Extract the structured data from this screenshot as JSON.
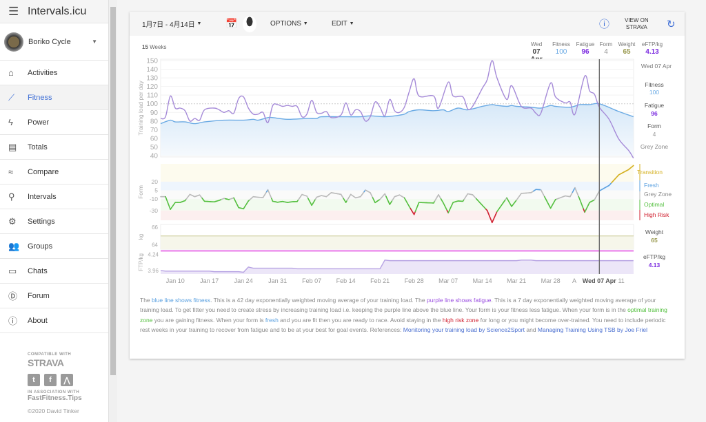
{
  "app": {
    "title": "Intervals.icu",
    "menu_icon": "hamburger-icon"
  },
  "profile": {
    "name": "Boriko Cycle"
  },
  "sidebar": {
    "items": [
      {
        "label": "Activities",
        "icon": "⌂",
        "name": "home-icon"
      },
      {
        "label": "Fitness",
        "icon": "⟋",
        "name": "trending-up-icon",
        "active": true
      },
      {
        "label": "Power",
        "icon": "ϟ",
        "name": "bolt-icon"
      },
      {
        "label": "Totals",
        "icon": "▤",
        "name": "totals-icon"
      },
      {
        "label": "Compare",
        "icon": "≈",
        "name": "compare-icon"
      },
      {
        "label": "Intervals",
        "icon": "⚲",
        "name": "search-icon"
      },
      {
        "label": "Settings",
        "icon": "⚙",
        "name": "gear-icon"
      },
      {
        "label": "Groups",
        "icon": "👥",
        "name": "groups-icon"
      },
      {
        "label": "Chats",
        "icon": "▭",
        "name": "chat-icon"
      },
      {
        "label": "Forum",
        "icon": "Ⓓ",
        "name": "forum-icon"
      },
      {
        "label": "About",
        "icon": "ⓘ",
        "name": "info-icon"
      }
    ]
  },
  "footer": {
    "compatible": "COMPATIBLE WITH",
    "strava": "STRAVA",
    "association": "IN ASSOCIATION WITH",
    "fastfitness": "FastFitness.Tips",
    "copyright": "©2020 David Tinker"
  },
  "toolbar": {
    "date_range": "1月7日 - 4月14日",
    "options": "OPTIONS",
    "edit": "EDIT",
    "view_on": "VIEW ON",
    "strava": "STRAVA"
  },
  "summary": {
    "weeks_num": "15",
    "weeks_label": "Weeks",
    "day": "Wed",
    "date": "07 Apr",
    "fitness_label": "Fitness",
    "fitness": "100",
    "fatigue_label": "Fatigue",
    "fatigue": "96",
    "form_label": "Form",
    "form": "4",
    "weight_label": "Weight",
    "weight": "65",
    "eftp_label": "eFTP/kg",
    "eftp": "4.13"
  },
  "right_panel": {
    "date": "Wed 07 Apr",
    "fitness_label": "Fitness",
    "fitness": "100",
    "fatigue_label": "Fatigue",
    "fatigue": "96",
    "form_label": "Form",
    "form": "4",
    "zone": "Grey Zone",
    "zones": [
      "Transition",
      "Fresh",
      "Grey Zone",
      "Optimal",
      "High Risk"
    ],
    "weight_label": "Weight",
    "weight": "65",
    "eftp_label": "eFTP/kg",
    "eftp": "4.13"
  },
  "colors": {
    "fitness": "#6aaae4",
    "fatigue": "#a58ad8",
    "fatigue_text": "#7b2be0",
    "weight": "#9a9a50",
    "transition": "#d4b020",
    "fresh": "#5aa0e0",
    "grey": "#bbbbbb",
    "optimal": "#55c040",
    "high_risk": "#d02030",
    "accent": "#3f6fd6"
  },
  "description": {
    "p1": "The ",
    "l1": "blue line shows fitness",
    "p2": ". This is a 42 day exponentially weighted moving average of your training load. The ",
    "l2": "purple line shows fatigue",
    "p3": ". This is a 7 day exponentially weighted moving average of your training load. To get fitter you need to create stress by increasing training load i.e. keeping the purple line above the blue line. Your form is your fitness less fatigue. When your form is in the ",
    "l3": "optimal training zone",
    "p4": " you are gaining fitness. When your form is ",
    "l4": "fresh",
    "p5": " and you are fit then you are ready to race. Avoid staying in the ",
    "l5": "high risk zone",
    "p6": " for long or you might become over-trained. You need to include periodic rest weeks in your training to recover from fatigue and to be at your best for goal events. References: ",
    "l6": "Monitoring your training load by Science2Sport",
    "p7": " and ",
    "l7": "Managing Training Using TSB by Joe Friel"
  },
  "chart_data": {
    "type": "line",
    "x_range": [
      "Jan 07",
      "Apr 14"
    ],
    "x_ticks": [
      "Jan 10",
      "Jan 17",
      "Jan 24",
      "Jan 31",
      "Feb 07",
      "Feb 14",
      "Feb 21",
      "Feb 28",
      "Mar 07",
      "Mar 14",
      "Mar 21",
      "Mar 28",
      "A",
      "Wed 07 Apr",
      "11"
    ],
    "selected_date": "Apr 07",
    "panels": [
      {
        "ylabel": "Training load per day",
        "ylim": [
          40,
          150
        ],
        "yticks": [
          150,
          140,
          130,
          120,
          110,
          100,
          90,
          80,
          70,
          60,
          50,
          40
        ],
        "series": [
          {
            "name": "Fitness",
            "color": "#6aaae4",
            "points": [
              [
                "Jan 07",
                77
              ],
              [
                "Jan 09",
                81
              ],
              [
                "Jan 10",
                79
              ],
              [
                "Jan 12",
                79
              ],
              [
                "Jan 14",
                77
              ],
              [
                "Jan 16",
                79
              ],
              [
                "Jan 20",
                81
              ],
              [
                "Jan 24",
                81
              ],
              [
                "Jan 26",
                82
              ],
              [
                "Jan 27",
                81
              ],
              [
                "Jan 29",
                84
              ],
              [
                "Jan 30",
                84
              ],
              [
                "Feb 02",
                82
              ],
              [
                "Feb 06",
                83
              ],
              [
                "Feb 08",
                83
              ],
              [
                "Feb 09",
                85
              ],
              [
                "Feb 13",
                85
              ],
              [
                "Feb 17",
                85
              ],
              [
                "Feb 19",
                86
              ],
              [
                "Feb 22",
                85
              ],
              [
                "Feb 24",
                86
              ],
              [
                "Feb 26",
                88
              ],
              [
                "Feb 27",
                91
              ],
              [
                "Mar 01",
                93
              ],
              [
                "Mar 04",
                92
              ],
              [
                "Mar 06",
                93
              ],
              [
                "Mar 07",
                91
              ],
              [
                "Mar 09",
                95
              ],
              [
                "Mar 11",
                93
              ],
              [
                "Mar 14",
                97
              ],
              [
                "Mar 16",
                99
              ],
              [
                "Mar 17",
                98
              ],
              [
                "Mar 19",
                97
              ],
              [
                "Mar 20",
                98
              ],
              [
                "Mar 21",
                97
              ],
              [
                "Mar 24",
                96
              ],
              [
                "Mar 26",
                95
              ],
              [
                "Mar 28",
                98
              ],
              [
                "Mar 29",
                97
              ],
              [
                "Apr 01",
                96
              ],
              [
                "Apr 03",
                99
              ],
              [
                "Apr 05",
                99
              ],
              [
                "Apr 07",
                100
              ],
              [
                "Apr 11",
                91
              ],
              [
                "Apr 14",
                85
              ]
            ]
          },
          {
            "name": "Fatigue",
            "color": "#a58ad8",
            "points": [
              [
                "Jan 07",
                83
              ],
              [
                "Jan 08",
                85
              ],
              [
                "Jan 09",
                109
              ],
              [
                "Jan 10",
                95
              ],
              [
                "Jan 11",
                95
              ],
              [
                "Jan 12",
                92
              ],
              [
                "Jan 13",
                80
              ],
              [
                "Jan 14",
                83
              ],
              [
                "Jan 15",
                81
              ],
              [
                "Jan 16",
                93
              ],
              [
                "Jan 18",
                95
              ],
              [
                "Jan 19",
                93
              ],
              [
                "Jan 20",
                90
              ],
              [
                "Jan 21",
                92
              ],
              [
                "Jan 22",
                89
              ],
              [
                "Jan 23",
                106
              ],
              [
                "Jan 24",
                108
              ],
              [
                "Jan 25",
                95
              ],
              [
                "Jan 26",
                88
              ],
              [
                "Jan 27",
                88
              ],
              [
                "Jan 28",
                90
              ],
              [
                "Jan 29",
                78
              ],
              [
                "Jan 30",
                98
              ],
              [
                "Jan 31",
                99
              ],
              [
                "Feb 01",
                97
              ],
              [
                "Feb 02",
                98
              ],
              [
                "Feb 03",
                97
              ],
              [
                "Feb 04",
                97
              ],
              [
                "Feb 05",
                85
              ],
              [
                "Feb 06",
                88
              ],
              [
                "Feb 07",
                104
              ],
              [
                "Feb 08",
                90
              ],
              [
                "Feb 09",
                89
              ],
              [
                "Feb 10",
                91
              ],
              [
                "Feb 11",
                84
              ],
              [
                "Feb 13",
                87
              ],
              [
                "Feb 14",
                101
              ],
              [
                "Feb 15",
                87
              ],
              [
                "Feb 16",
                93
              ],
              [
                "Feb 17",
                91
              ],
              [
                "Feb 18",
                80
              ],
              [
                "Feb 19",
                85
              ],
              [
                "Feb 20",
                102
              ],
              [
                "Feb 21",
                96
              ],
              [
                "Feb 22",
                86
              ],
              [
                "Feb 23",
                105
              ],
              [
                "Feb 24",
                92
              ],
              [
                "Feb 25",
                90
              ],
              [
                "Feb 26",
                96
              ],
              [
                "Feb 27",
                114
              ],
              [
                "Feb 28",
                129
              ],
              [
                "Mar 01",
                109
              ],
              [
                "Mar 04",
                109
              ],
              [
                "Mar 05",
                95
              ],
              [
                "Mar 07",
                125
              ],
              [
                "Mar 08",
                109
              ],
              [
                "Mar 10",
                108
              ],
              [
                "Mar 11",
                94
              ],
              [
                "Mar 12",
                97
              ],
              [
                "Mar 14",
                118
              ],
              [
                "Mar 15",
                128
              ],
              [
                "Mar 16",
                150
              ],
              [
                "Mar 17",
                130
              ],
              [
                "Mar 19",
                105
              ],
              [
                "Mar 20",
                121
              ],
              [
                "Mar 22",
                97
              ],
              [
                "Mar 24",
                95
              ],
              [
                "Mar 25",
                89
              ],
              [
                "Mar 26",
                89
              ],
              [
                "Mar 28",
                124
              ],
              [
                "Mar 29",
                108
              ],
              [
                "Mar 31",
                101
              ],
              [
                "Apr 01",
                102
              ],
              [
                "Apr 02",
                88
              ],
              [
                "Apr 04",
                132
              ],
              [
                "Apr 05",
                115
              ],
              [
                "Apr 06",
                111
              ],
              [
                "Apr 07",
                96
              ],
              [
                "Apr 09",
                82
              ],
              [
                "Apr 11",
                59
              ],
              [
                "Apr 13",
                46
              ],
              [
                "Apr 14",
                37
              ]
            ]
          }
        ]
      },
      {
        "ylabel": "Form",
        "yticks": [
          20,
          5,
          -10,
          -30
        ],
        "ylim": [
          -47,
          51
        ],
        "series": [
          {
            "name": "Form",
            "derived": "Fitness - Fatigue"
          }
        ],
        "zones": [
          {
            "name": "Transition",
            "from": 20
          },
          {
            "name": "Fresh",
            "from": 5,
            "to": 20
          },
          {
            "name": "Grey Zone",
            "from": -10,
            "to": 5
          },
          {
            "name": "Optimal",
            "from": -30,
            "to": -10
          },
          {
            "name": "High Risk",
            "to": -30
          }
        ]
      },
      {
        "ylabel": "kg",
        "yticks": [
          66,
          64
        ],
        "ylim": [
          63.5,
          66.3
        ],
        "series": [
          {
            "name": "Weight",
            "color": "#9a9a50",
            "points": [
              [
                "Jan 07",
                65
              ],
              [
                "Apr 14",
                65
              ]
            ]
          }
        ]
      },
      {
        "ylabel": "FTP/kg",
        "yticks": [
          4.24,
          3.96
        ],
        "ylim": [
          3.9,
          4.28
        ],
        "series": [
          {
            "name": "eFTP/kg",
            "color": "#b7a3e3",
            "points": [
              [
                "Jan 07",
                3.96
              ],
              [
                "Jan 08",
                3.95
              ],
              [
                "Jan 17",
                3.95
              ],
              [
                "Jan 18",
                3.94
              ],
              [
                "Jan 23",
                3.94
              ],
              [
                "Jan 24",
                3.93
              ],
              [
                "Jan 25",
                4.02
              ],
              [
                "Jan 26",
                4.0
              ],
              [
                "Feb 03",
                4.0
              ],
              [
                "Feb 04",
                3.99
              ],
              [
                "Feb 21",
                3.99
              ],
              [
                "Feb 22",
                4.14
              ],
              [
                "Feb 23",
                4.13
              ],
              [
                "Mar 21",
                4.13
              ],
              [
                "Mar 22",
                4.14
              ],
              [
                "Mar 24",
                4.14
              ],
              [
                "Mar 25",
                4.13
              ],
              [
                "Apr 14",
                4.13
              ]
            ]
          }
        ]
      }
    ]
  }
}
